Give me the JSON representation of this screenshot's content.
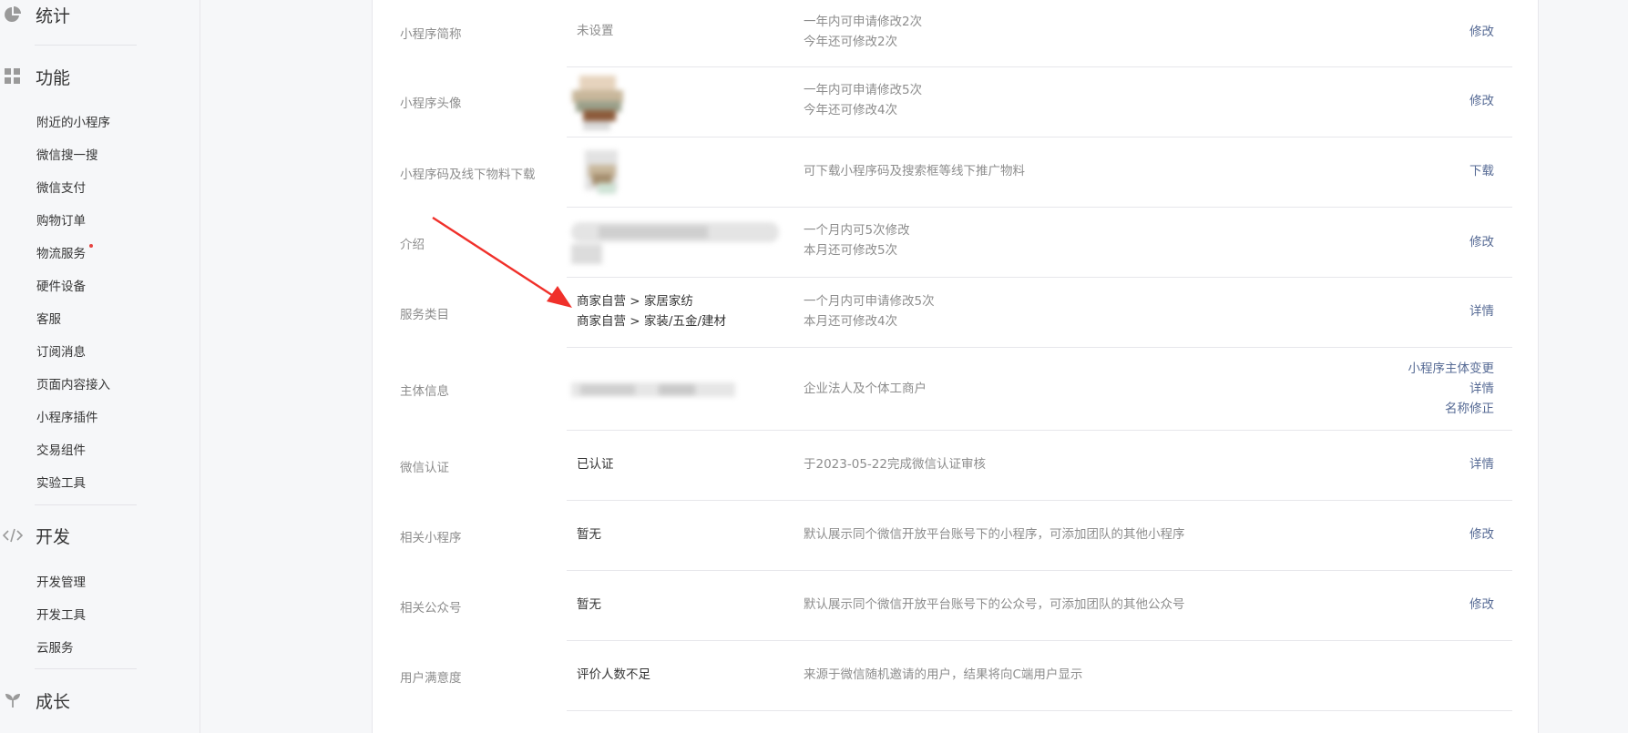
{
  "sidebar": {
    "sections": {
      "stats": "统计",
      "features": "功能",
      "dev": "开发",
      "growth": "成长"
    },
    "feature_items": [
      "附近的小程序",
      "微信搜一搜",
      "微信支付",
      "购物订单",
      "物流服务",
      "硬件设备",
      "客服",
      "订阅消息",
      "页面内容接入",
      "小程序插件",
      "交易组件",
      "实验工具"
    ],
    "dev_items": [
      "开发管理",
      "开发工具",
      "云服务"
    ],
    "icons": {
      "stats": "pie-chart-icon",
      "features": "grid-icon",
      "dev": "code-icon",
      "growth": "sprout-icon"
    },
    "badge_color": "#e64340"
  },
  "rows": [
    {
      "label": "小程序简称",
      "value": "未设置",
      "desc": [
        "一年内可申请修改2次",
        "今年还可修改2次"
      ],
      "actions": [
        "修改"
      ]
    },
    {
      "label": "小程序头像",
      "value": "",
      "desc": [
        "一年内可申请修改5次",
        "今年还可修改4次"
      ],
      "actions": [
        "修改"
      ]
    },
    {
      "label": "小程序码及线下物料下载",
      "value": "",
      "desc": [
        "可下载小程序码及搜索框等线下推广物料"
      ],
      "actions": [
        "下载"
      ]
    },
    {
      "label": "介绍",
      "value": "",
      "desc": [
        "一个月内可5次修改",
        "本月还可修改5次"
      ],
      "actions": [
        "修改"
      ]
    },
    {
      "label": "服务类目",
      "value": [
        "商家自营 > 家居家纺",
        "商家自营 > 家装/五金/建材"
      ],
      "desc": [
        "一个月内可申请修改5次",
        "本月还可修改4次"
      ],
      "actions": [
        "详情"
      ]
    },
    {
      "label": "主体信息",
      "value": "",
      "desc": [
        "企业法人及个体工商户"
      ],
      "actions": [
        "小程序主体变更",
        "详情",
        "名称修正"
      ]
    },
    {
      "label": "微信认证",
      "value": "已认证",
      "desc": [
        "于2023-05-22完成微信认证审核"
      ],
      "actions": [
        "详情"
      ]
    },
    {
      "label": "相关小程序",
      "value": "暂无",
      "desc": [
        "默认展示同个微信开放平台账号下的小程序，可添加团队的其他小程序"
      ],
      "actions": [
        "修改"
      ]
    },
    {
      "label": "相关公众号",
      "value": "暂无",
      "desc": [
        "默认展示同个微信开放平台账号下的公众号，可添加团队的其他公众号"
      ],
      "actions": [
        "修改"
      ]
    },
    {
      "label": "用户满意度",
      "value": "评价人数不足",
      "desc": [
        "来源于微信随机邀请的用户，结果将向C端用户显示"
      ],
      "actions": []
    }
  ],
  "colors": {
    "link": "#576b95",
    "muted": "#8d8d8d",
    "text": "#353535",
    "arrow": "#f0302a"
  }
}
